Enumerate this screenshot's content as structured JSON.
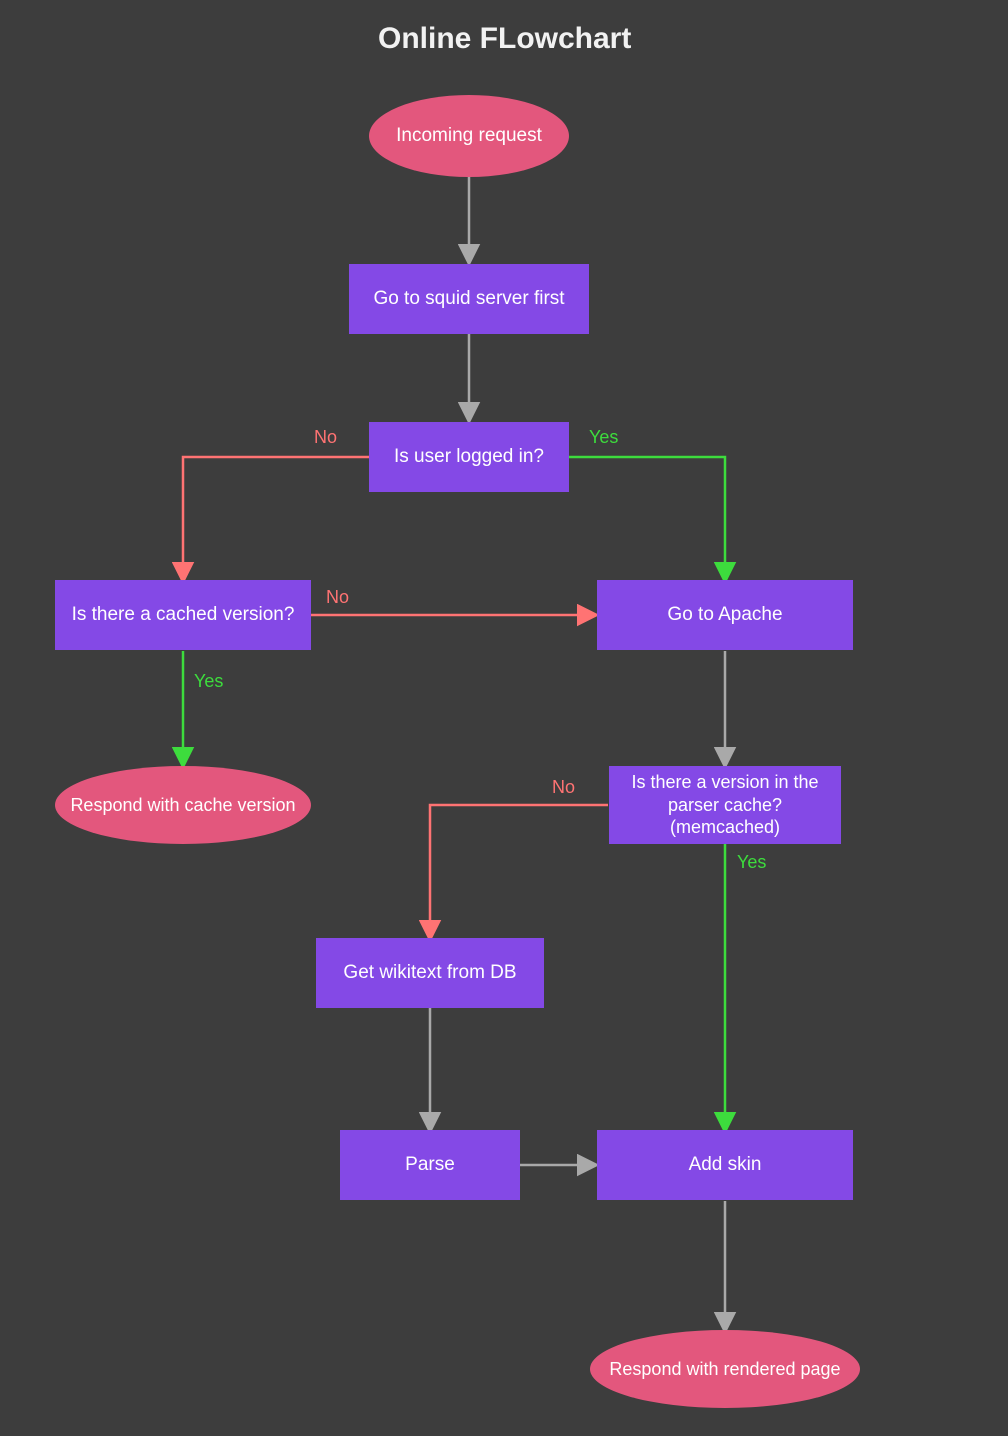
{
  "title": "Online FLowchart",
  "labels": {
    "yes": "Yes",
    "no": "No"
  },
  "nodes": {
    "incoming": {
      "text": "Incoming request"
    },
    "squid": {
      "text": "Go to squid server first"
    },
    "logged_in": {
      "text": "Is user logged in?"
    },
    "cached": {
      "text": "Is there a cached version?"
    },
    "apache": {
      "text": "Go to Apache"
    },
    "respond_cache": {
      "text": "Respond with cache version"
    },
    "parser_cache": {
      "text": "Is there a version in the parser cache? (memcached)"
    },
    "wikitext": {
      "text": "Get wikitext from DB"
    },
    "parse": {
      "text": "Parse"
    },
    "add_skin": {
      "text": "Add skin"
    },
    "respond_page": {
      "text": "Respond with rendered page"
    }
  },
  "colors": {
    "bg": "#3d3d3d",
    "rect": "#8449e6",
    "ellipse": "#e3577d",
    "arrow_default": "#a9a9a9",
    "arrow_yes": "#3ddc3d",
    "arrow_no": "#ff7373"
  }
}
